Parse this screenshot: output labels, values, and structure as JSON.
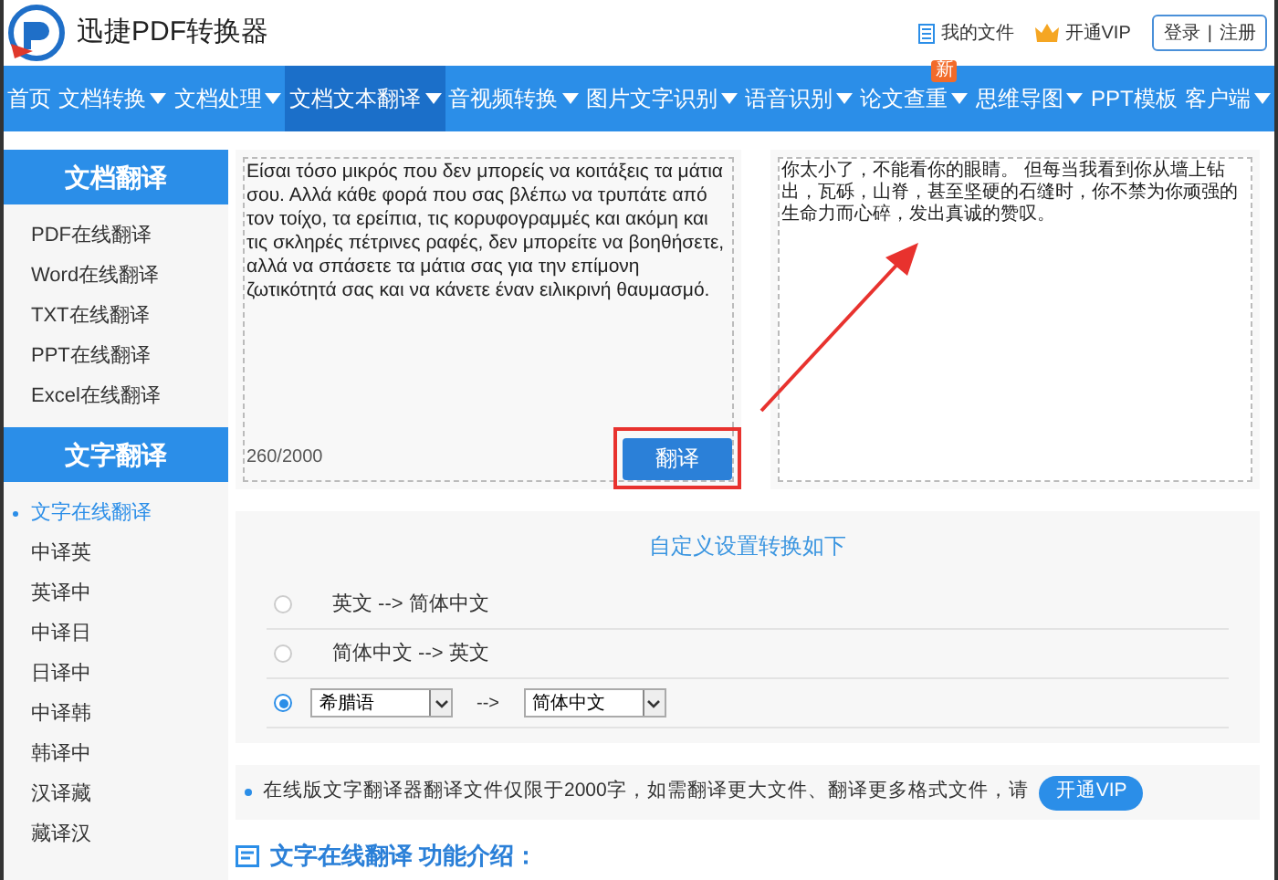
{
  "app": {
    "title": "迅捷PDF转换器"
  },
  "header_links": [
    {
      "kind": "file",
      "label": "我的文件"
    },
    {
      "kind": "vip",
      "label": "开通VIP"
    }
  ],
  "auth": {
    "login": "登录",
    "separator": "|",
    "register": "注册"
  },
  "nav": [
    {
      "label": "首页",
      "has_menu": false,
      "selected": false
    },
    {
      "label": "文档转换",
      "has_menu": true,
      "selected": false
    },
    {
      "label": "文档处理",
      "has_menu": true,
      "selected": false
    },
    {
      "label": "文档文本翻译",
      "has_menu": true,
      "selected": true
    },
    {
      "label": "音视频转换",
      "has_menu": true,
      "selected": false
    },
    {
      "label": "图片文字识别",
      "has_menu": true,
      "selected": false
    },
    {
      "label": "语音识别",
      "has_menu": true,
      "selected": false
    },
    {
      "label": "论文查重",
      "has_menu": true,
      "selected": false,
      "badge": "新"
    },
    {
      "label": "思维导图",
      "has_menu": true,
      "selected": false
    },
    {
      "label": "PPT模板",
      "has_menu": false,
      "selected": false
    },
    {
      "label": "客户端",
      "has_menu": true,
      "selected": false
    }
  ],
  "sidebar": [
    {
      "title": "文档翻译",
      "items": [
        {
          "label": "PDF在线翻译",
          "selected": false
        },
        {
          "label": "Word在线翻译",
          "selected": false
        },
        {
          "label": "TXT在线翻译",
          "selected": false
        },
        {
          "label": "PPT在线翻译",
          "selected": false
        },
        {
          "label": "Excel在线翻译",
          "selected": false
        }
      ]
    },
    {
      "title": "文字翻译",
      "items": [
        {
          "label": "文字在线翻译",
          "selected": true
        },
        {
          "label": "中译英",
          "selected": false
        },
        {
          "label": "英译中",
          "selected": false
        },
        {
          "label": "中译日",
          "selected": false
        },
        {
          "label": "日译中",
          "selected": false
        },
        {
          "label": "中译韩",
          "selected": false
        },
        {
          "label": "韩译中",
          "selected": false
        },
        {
          "label": "汉译藏",
          "selected": false
        },
        {
          "label": "藏译汉",
          "selected": false
        }
      ]
    }
  ],
  "translator": {
    "source_text": "Είσαι τόσο μικρός που δεν μπορείς να κοιτάξεις τα μάτια σου. Αλλά κάθε φορά που σας βλέπω να τρυπάτε από τον τοίχο, τα ερείπια, τις κορυφογραμμές και ακόμη και τις σκληρές πέτρινες ραφές, δεν μπορείτε να βοηθήσετε, αλλά να σπάσετε τα μάτια σας για την επίμονη ζωτικότητά σας και να κάνετε έναν ειλικρινή θαυμασμό.",
    "char_count": "260/2000",
    "translate_button": "翻译",
    "result_text": "你太小了，不能看你的眼睛。 但每当我看到你从墙上钻出，瓦砾，山脊，甚至坚硬的石缝时，你不禁为你顽强的生命力而心碎，发出真诚的赞叹。"
  },
  "settings": {
    "title": "自定义设置转换如下",
    "options": [
      {
        "kind": "text",
        "label": "英文 --> 简体中文",
        "selected": false
      },
      {
        "kind": "text",
        "label": "简体中文 --> 英文",
        "selected": false
      },
      {
        "kind": "select",
        "from": "希腊语",
        "arrow": "-->",
        "to": "简体中文",
        "selected": true
      }
    ]
  },
  "notice": {
    "text": "在线版文字翻译器翻译文件仅限于2000字，如需翻译更大文件、翻译更多格式文件，请",
    "button": "开通VIP"
  },
  "section_title": "文字在线翻译 功能介绍："
}
